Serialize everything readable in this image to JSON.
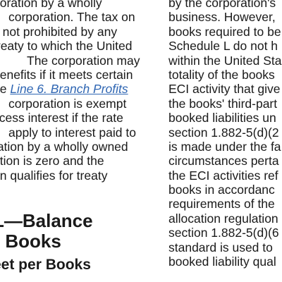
{
  "left_column": {
    "lines": [
      "poration by a wholly",
      "corporation. The tax on",
      "s not prohibited by any",
      "treaty to which the United",
      "The corporation may",
      "benefits if it meets certain"
    ],
    "line7_prefix": "ee ",
    "line7_link": "Line 6. Branch Profits",
    "lines_after_link": [
      "corporation is exempt",
      "xcess interest if the rate",
      "apply to interest paid to",
      "ration by a wholly owned",
      "ation is zero and the",
      "on qualifies for treaty"
    ],
    "heading_line1": "L—Balance",
    "heading_line2": "r Books",
    "subheading": "eet per Books"
  },
  "right_column": {
    "lines": [
      "by the corporation's",
      "business. However,",
      "books required to be",
      "Schedule L do not h",
      "within the United Sta",
      "totality of the books",
      "ECI activity that give",
      "the books' third-part",
      "booked liabilities un",
      "section 1.882-5(d)(2",
      "is made under the fa",
      "circumstances perta",
      "the ECI activities ref",
      "books in accordanc",
      "requirements of the",
      "allocation regulation",
      "section 1.882-5(d)(6",
      "standard is used to",
      "booked liability qual"
    ]
  },
  "colors": {
    "text": "#1a1a1a",
    "link": "#2f66b3",
    "background": "#ffffff"
  }
}
